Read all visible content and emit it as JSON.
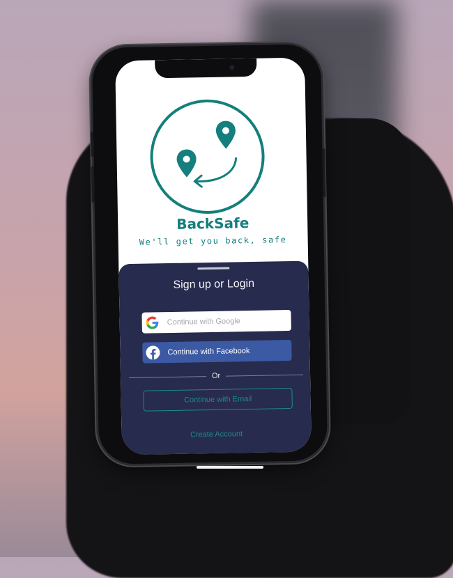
{
  "app": {
    "brand_name": "BackSafe",
    "tagline": "We'll get you back, safe",
    "accent_color": "#147f7c"
  },
  "auth_sheet": {
    "title": "Sign up or Login",
    "google_button": {
      "label": "Continue with Google",
      "icon": "google-icon"
    },
    "facebook_button": {
      "label": "Continue with Facebook",
      "icon": "facebook-icon"
    },
    "divider_text": "Or",
    "email_button": {
      "label": "Continue with Email"
    },
    "create_account_link": "Create Account",
    "background_color": "#272b4d"
  }
}
